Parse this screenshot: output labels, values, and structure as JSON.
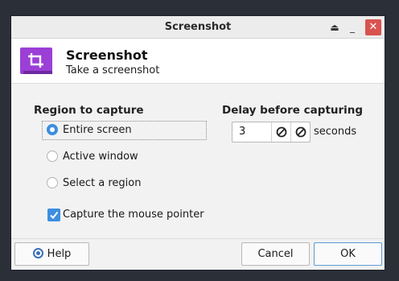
{
  "window": {
    "title": "Screenshot"
  },
  "header": {
    "app_title": "Screenshot",
    "app_subtitle": "Take a screenshot",
    "icon": "crop-icon",
    "icon_color": "#9b3fd6"
  },
  "region": {
    "title": "Region to capture",
    "options": [
      {
        "label": "Entire screen",
        "selected": true
      },
      {
        "label": "Active window",
        "selected": false
      },
      {
        "label": "Select a region",
        "selected": false
      }
    ],
    "mouse_pointer_label": "Capture the mouse pointer",
    "mouse_pointer_checked": true
  },
  "delay": {
    "title": "Delay before capturing",
    "value": "3",
    "unit_label": "seconds"
  },
  "buttons": {
    "help": "Help",
    "cancel": "Cancel",
    "ok": "OK"
  },
  "colors": {
    "accent": "#3d8ee0",
    "close": "#d9534f"
  }
}
